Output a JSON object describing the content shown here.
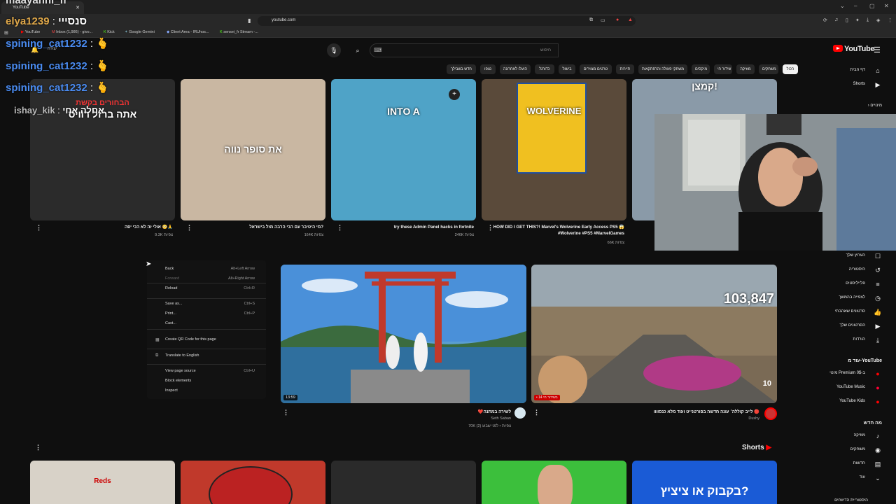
{
  "browser": {
    "tab_title": "YouTube",
    "url": "youtube.com",
    "bookmarks": [
      "YouTube",
      "Inbox (1,986) - givo...",
      "Kick",
      "Google Gemini",
      "Client Area - IRUhos...",
      "sensei_fr Stream -..."
    ]
  },
  "overlay": {
    "top_banner": "maayanhi_fr",
    "chat": [
      {
        "user": "elya1239",
        "text": "סנסייי",
        "color": "#e0a84a"
      },
      {
        "user": "spining_cat1232",
        "text": "🫰",
        "color": "#4a8bf0"
      },
      {
        "user": "spining_cat1232",
        "text": "🫰",
        "color": "#4a8bf0"
      },
      {
        "user": "spining_cat1232",
        "text": "🫰",
        "color": "#4a8bf0"
      },
      {
        "user": "ishay_kik",
        "text": "אחלה אחי",
        "color": "#bbbbbb"
      }
    ]
  },
  "header": {
    "logo": "YouTube",
    "search_placeholder": "חיפוש",
    "cast_label": "יצירה"
  },
  "chips": [
    "הכול",
    "משחקים",
    "מוזיקה",
    "שידור חי",
    "מיקסים",
    "משחקי פעולה והרפתקאות",
    "תיירות",
    "טרטים מצוירים",
    "בישול",
    "כדורגל",
    "הועלו לאחרונה",
    "נצפו",
    "חדש בשבילך"
  ],
  "sidebar": {
    "top": [
      {
        "label": "דף הבית",
        "icon": "home-icon",
        "glyph": "⌂"
      },
      {
        "label": "Shorts",
        "icon": "shorts-icon",
        "glyph": "▶"
      }
    ],
    "subs_label": "מינויים",
    "you_items": [
      {
        "label": "הערוץ שלך",
        "icon": "channel-icon",
        "glyph": "☐"
      },
      {
        "label": "היסטוריה",
        "icon": "history-icon",
        "glyph": "↺"
      },
      {
        "label": "פלייליסטים",
        "icon": "playlist-icon",
        "glyph": "≡"
      },
      {
        "label": "לצפייה בהמשך",
        "icon": "clock-icon",
        "glyph": "◷"
      },
      {
        "label": "סרטונים שאהבתי",
        "icon": "like-icon",
        "glyph": "👍"
      },
      {
        "label": "הסרטונים שלך",
        "icon": "video-icon",
        "glyph": "▶"
      },
      {
        "label": "הורדות",
        "icon": "download-icon",
        "glyph": "⤓"
      }
    ],
    "more_from_title": "עוד מ-YouTube",
    "more_from": [
      {
        "label": "מינוי Premium ב-0$",
        "icon": "premium-icon",
        "glyph": "●"
      },
      {
        "label": "YouTube Music",
        "icon": "music-icon",
        "glyph": "●"
      },
      {
        "label": "YouTube Kids",
        "icon": "kids-icon",
        "glyph": "●"
      }
    ],
    "whats_new_title": "מה חדש",
    "whats_new": [
      {
        "label": "מוזיקה",
        "icon": "music-note-icon",
        "glyph": "♪"
      },
      {
        "label": "משחקים",
        "icon": "gaming-icon",
        "glyph": "◉"
      },
      {
        "label": "חדשות",
        "icon": "news-icon",
        "glyph": "▤"
      },
      {
        "label": "עוד",
        "icon": "more-icon",
        "glyph": "⌄"
      }
    ],
    "bottom": "היסטוריית הדיווחים"
  },
  "row1": [
    {
      "title": "אולי זה לא הכי יפה 😳🙏",
      "meta": "9.3K צפיות",
      "thumb_text": "אתה ברזל רוויס",
      "thumb_subtext": "הבחורים בקשת",
      "bg": "#2b2b2b"
    },
    {
      "title": "מי היטיבר עם הכי הרבה מזל בישראל?",
      "meta": "164K צפיות",
      "thumb_text": "את סופר נווה",
      "bg": "#c9b7a2"
    },
    {
      "title": "try these Admin Panel hacks in fortnite",
      "meta": "246K צפיות",
      "thumb_text": "INTO A",
      "bg": "#4fa3c7"
    },
    {
      "title": "HOW DID I GET THIS?! Marvel's Wolverine Early Access PS5 😱 #Wolverine #PS5 #MarvelGames",
      "meta": "66K צפיות",
      "thumb_text": "WOLVERINE",
      "bg": "#5a4a3a"
    },
    {
      "title": "",
      "meta": "",
      "thumb_text": "קמצן!",
      "bg": "#8a9aa8"
    }
  ],
  "row2": [
    {
      "title": "❤️לשירה במתנה",
      "channel": "Seth Saban",
      "meta": "70K צפיות • לפני שבוע (2)",
      "duration": "13:59",
      "bg": "#3d7fb8"
    },
    {
      "title": "לייב קוללה׳ עונה חדשה בפורטנייט ועוד מלא כנסוווו 🔴",
      "channel": "Dushy",
      "meta": "",
      "counter": "103,847",
      "live_badge": "• 14 בשידור חי",
      "badge": "10",
      "bg": "#7a6a55"
    }
  ],
  "context_menu": [
    {
      "label": "Back",
      "shortcut": "Alt+Left Arrow",
      "dim": false
    },
    {
      "label": "Forward",
      "shortcut": "Alt+Right Arrow",
      "dim": true
    },
    {
      "label": "Reload",
      "shortcut": "Ctrl+R",
      "dim": false
    },
    {
      "label": "Save as...",
      "shortcut": "Ctrl+S",
      "dim": false
    },
    {
      "label": "Print...",
      "shortcut": "Ctrl+P",
      "dim": false
    },
    {
      "label": "Cast...",
      "shortcut": "",
      "dim": false
    },
    {
      "label": "Create QR Code for this page",
      "shortcut": "",
      "dim": false
    },
    {
      "label": "Translate to English",
      "shortcut": "",
      "dim": false
    },
    {
      "label": "View page source",
      "shortcut": "Ctrl+U",
      "dim": false
    },
    {
      "label": "Block elements",
      "shortcut": "",
      "dim": false
    },
    {
      "label": "Inspect",
      "shortcut": "",
      "dim": false
    }
  ],
  "shorts": {
    "title": "Shorts",
    "thumbs": [
      {
        "text": "Reds",
        "bg": "#d8d2c8"
      },
      {
        "text": "",
        "bg": "#c0392b"
      },
      {
        "text": "",
        "bg": "#2a2a2a"
      },
      {
        "text": "",
        "bg": "#3cbf3c"
      },
      {
        "text": "בקבוק או ציציץ?",
        "bg": "#1a5bd6"
      }
    ]
  }
}
